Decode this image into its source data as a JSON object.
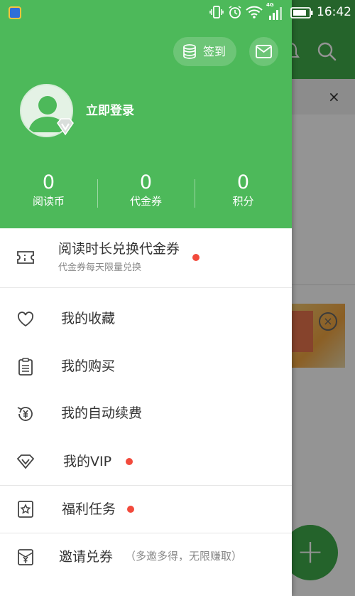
{
  "status_bar": {
    "time": "16:42",
    "network_label": "4G"
  },
  "drawer": {
    "checkin_label": "签到",
    "login_text": "立即登录",
    "stats": [
      {
        "value": "0",
        "label": "阅读币"
      },
      {
        "value": "0",
        "label": "代金券"
      },
      {
        "value": "0",
        "label": "积分"
      }
    ],
    "promo": {
      "title": "阅读时长兑换代金券",
      "subtitle": "代金券每天限量兑换"
    },
    "menu": {
      "favorites": "我的收藏",
      "purchases": "我的购买",
      "auto_renew": "我的自动续费",
      "vip": "我的VIP",
      "tasks": "福利任务",
      "invite": "邀请兑券",
      "invite_note": "（多邀多得，无限赚取）"
    }
  },
  "background": {
    "close_glyph": "×"
  },
  "colors": {
    "brand_green": "#4db95a",
    "notification_red": "#f24a3c"
  }
}
